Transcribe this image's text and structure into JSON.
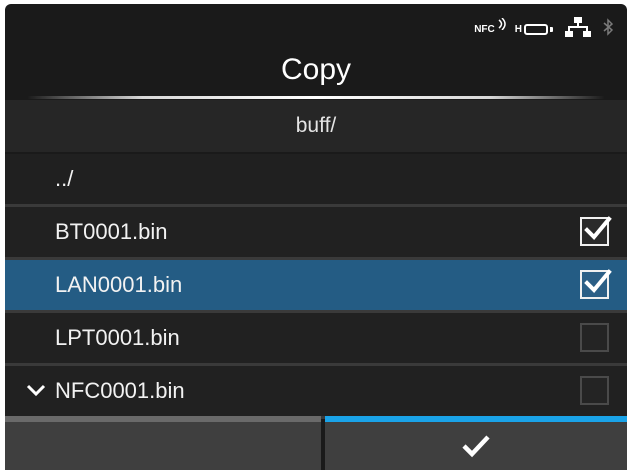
{
  "screen": {
    "title": "Copy",
    "path": "buff/"
  },
  "status_bar": {
    "nfc_label": "NFC",
    "battery_label": "H",
    "icons": [
      "nfc-icon",
      "battery-icon",
      "network-icon",
      "bluetooth-icon"
    ]
  },
  "file_list": {
    "items": [
      {
        "name": "../",
        "type": "parent",
        "checked": null,
        "selected": false
      },
      {
        "name": "BT0001.bin",
        "type": "file",
        "checked": true,
        "selected": false
      },
      {
        "name": "LAN0001.bin",
        "type": "file",
        "checked": true,
        "selected": true
      },
      {
        "name": "LPT0001.bin",
        "type": "file",
        "checked": false,
        "selected": false
      },
      {
        "name": "NFC0001.bin",
        "type": "file",
        "checked": false,
        "selected": false,
        "indicator": "chevron-down-icon"
      }
    ]
  },
  "buttons": {
    "left": {
      "label": ""
    },
    "right": {
      "icon": "checkmark-icon"
    }
  },
  "colors": {
    "background": "#1a1a1a",
    "selected_row": "#245c84",
    "accent_confirm": "#1aa3e8"
  }
}
